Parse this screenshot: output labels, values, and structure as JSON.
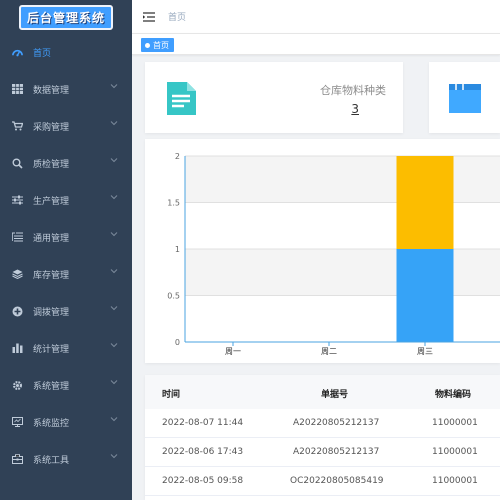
{
  "app": {
    "logo_text": "后台管理系统"
  },
  "sidebar": {
    "items": [
      {
        "label": "首页",
        "icon": "dashboard-icon",
        "active": true,
        "has_children": false
      },
      {
        "label": "数据管理",
        "icon": "grid-icon",
        "has_children": true
      },
      {
        "label": "采购管理",
        "icon": "cart-icon",
        "has_children": true
      },
      {
        "label": "质检管理",
        "icon": "search-icon",
        "has_children": true
      },
      {
        "label": "生产管理",
        "icon": "sliders-icon",
        "has_children": true
      },
      {
        "label": "通用管理",
        "icon": "list-icon",
        "has_children": true
      },
      {
        "label": "库存管理",
        "icon": "layers-icon",
        "has_children": true
      },
      {
        "label": "调拨管理",
        "icon": "transfer-icon",
        "has_children": true
      },
      {
        "label": "统计管理",
        "icon": "bar-chart-icon",
        "has_children": true
      },
      {
        "label": "系统管理",
        "icon": "gear-icon",
        "has_children": true
      },
      {
        "label": "系统监控",
        "icon": "monitor-icon",
        "has_children": true
      },
      {
        "label": "系统工具",
        "icon": "toolbox-icon",
        "has_children": true
      }
    ]
  },
  "header": {
    "breadcrumb": "首页"
  },
  "tags": [
    {
      "label": "首页",
      "active": true
    }
  ],
  "stats": [
    {
      "title": "仓库物料种类",
      "value": "3",
      "icon": "document-icon",
      "icon_color": "#36c6c6"
    },
    {
      "title": "",
      "value": "",
      "icon": "folder-icon",
      "icon_color": "#40a9ff"
    }
  ],
  "chart_data": {
    "type": "bar",
    "stacked": true,
    "categories": [
      "周一",
      "周二",
      "周三"
    ],
    "series": [
      {
        "values": [
          0,
          0,
          1
        ],
        "color": "#36a3f7"
      },
      {
        "values": [
          0,
          0,
          1
        ],
        "color": "#fcbd00"
      }
    ],
    "yticks": [
      "0",
      "0.5",
      "1",
      "1.5",
      "2"
    ],
    "ylim": [
      0,
      2
    ],
    "grid": true
  },
  "table": {
    "columns": [
      "时间",
      "单据号",
      "物料编码"
    ],
    "rows": [
      [
        "2022-08-07 11:44",
        "A20220805212137",
        "11000001"
      ],
      [
        "2022-08-06 17:43",
        "A20220805212137",
        "11000001"
      ],
      [
        "2022-08-05 09:58",
        "OC20220805085419",
        "11000001"
      ]
    ]
  }
}
